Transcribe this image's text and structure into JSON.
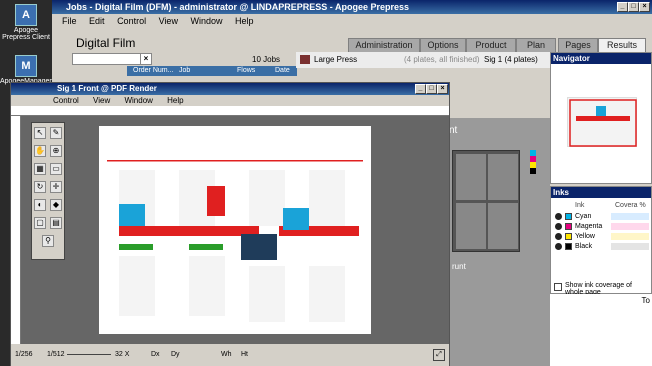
{
  "desktop": {
    "icons": [
      {
        "label": "Apogee Prepress Client",
        "glyph": "A"
      },
      {
        "label": "ApogeeManagement",
        "glyph": "M"
      }
    ]
  },
  "main": {
    "title": "Jobs - Digital Film (DFM) - administrator @ LINDAPREPRESS - Apogee Prepress",
    "menu": [
      "File",
      "Edit",
      "Control",
      "View",
      "Window",
      "Help"
    ],
    "jobs": {
      "title": "Digital Film",
      "count": "10 Jobs",
      "columns": [
        "Order Num...",
        "Job",
        "Flows",
        "Date"
      ]
    },
    "tabs": [
      "Administration",
      "Options",
      "Product",
      "Plan",
      "Pages",
      "Results"
    ],
    "active_tab": "Results",
    "press": {
      "name": "Large Press",
      "plates": "(4 plates, all finished)",
      "sig": "Sig 1 (4 plates)"
    }
  },
  "navigator": {
    "title": "Navigator"
  },
  "inks": {
    "title": "Inks",
    "columns": [
      "Ink",
      "Covera %"
    ],
    "items": [
      {
        "name": "Cyan",
        "color": "#00b4e6",
        "bar": "#d8ecff"
      },
      {
        "name": "Magenta",
        "color": "#e6007e",
        "bar": "#ffd8ec"
      },
      {
        "name": "Yellow",
        "color": "#ffe600",
        "bar": "#fff6c8"
      },
      {
        "name": "Black",
        "color": "#000000",
        "bar": "#e4e4e4"
      }
    ],
    "show_coverage_label": "Show ink coverage of whole page"
  },
  "pdf": {
    "title": "Sig 1 Front @ PDF Render",
    "menu": [
      "Control",
      "View",
      "Window",
      "Help"
    ],
    "zoom_min": "1/256",
    "zoom_current": "1/512",
    "zoom_max": "32 X",
    "pos_x": "Dx",
    "pos_y": "Dy",
    "size_w": "Wh",
    "size_h": "Ht"
  },
  "side": {
    "front_label": "nt",
    "run_label": "runt",
    "to_label": "To"
  },
  "sheet_colors": {
    "red": "#e02020",
    "cyan": "#1aa3d8",
    "green": "#2a9d2a",
    "dark": "#1f3c5a"
  }
}
